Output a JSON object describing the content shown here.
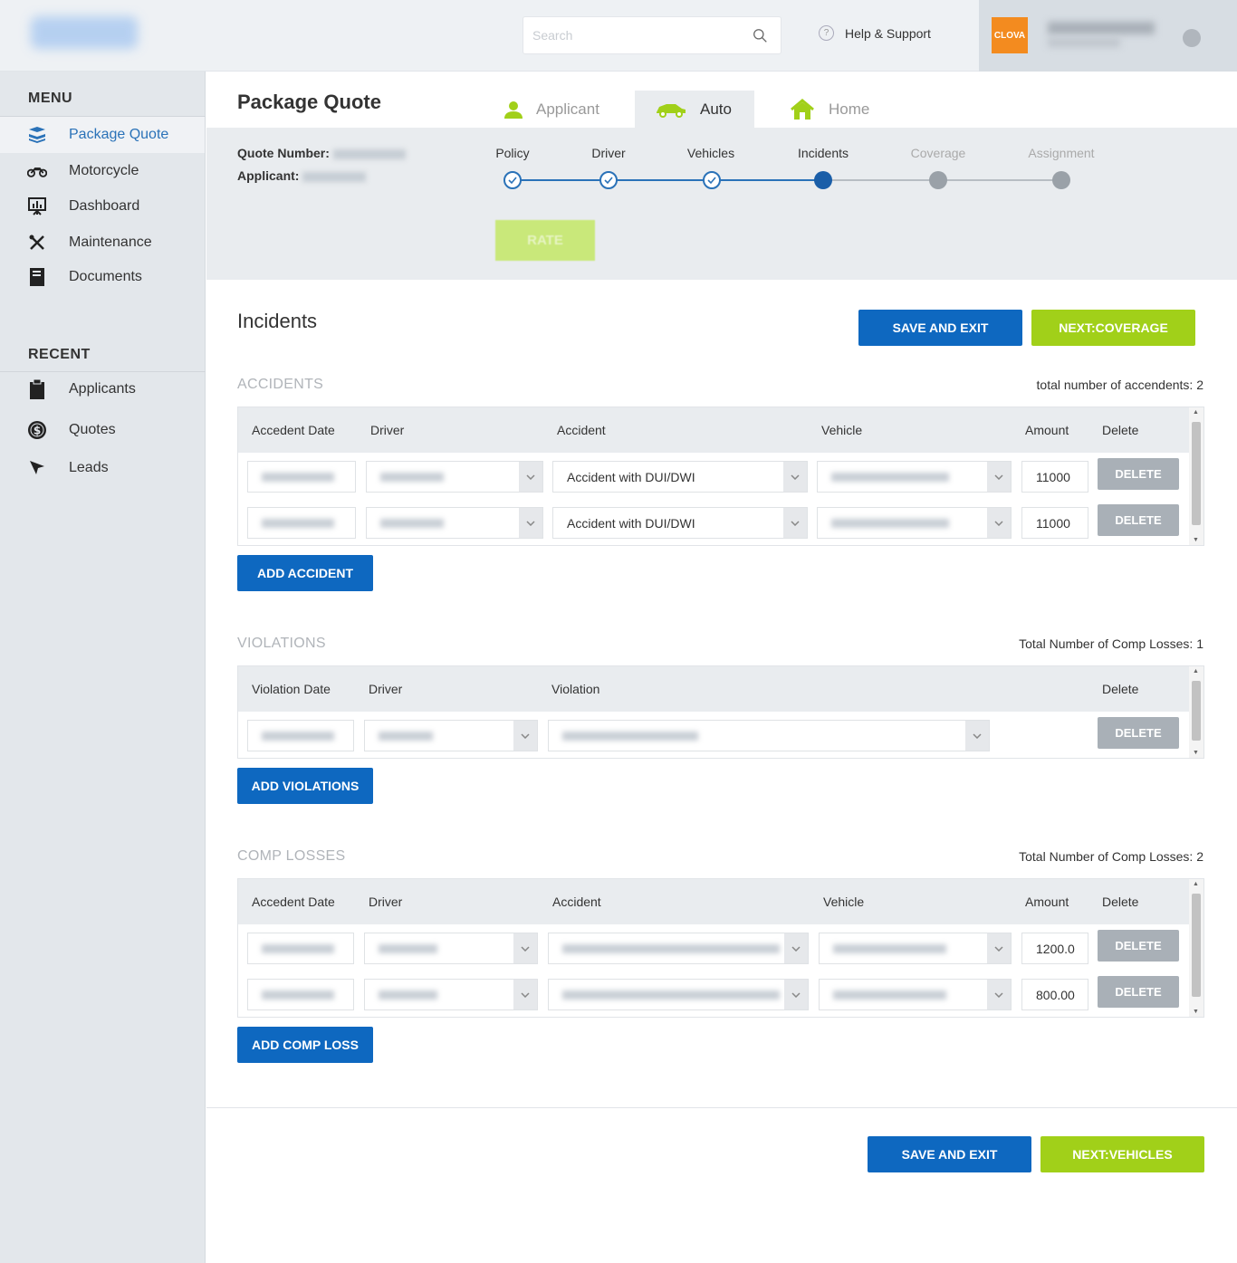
{
  "header": {
    "search_placeholder": "Search",
    "help_label": "Help & Support",
    "brand_text": "CLOVA"
  },
  "colors": {
    "primary": "#0e68c0",
    "accent": "#a1d019",
    "brand": "#f38b1f"
  },
  "sidebar": {
    "menu_title": "MENU",
    "menu": [
      {
        "label": "Package Quote",
        "icon": "package-icon"
      },
      {
        "label": "Motorcycle",
        "icon": "motorcycle-icon"
      },
      {
        "label": "Dashboard",
        "icon": "dashboard-icon"
      },
      {
        "label": "Maintenance",
        "icon": "tools-icon"
      },
      {
        "label": "Documents",
        "icon": "document-icon"
      }
    ],
    "recent_title": "RECENT",
    "recent": [
      {
        "label": "Applicants",
        "icon": "clipboard-icon"
      },
      {
        "label": "Quotes",
        "icon": "dollar-icon"
      },
      {
        "label": "Leads",
        "icon": "cursor-icon"
      }
    ]
  },
  "page": {
    "title": "Package Quote",
    "quote_label": "Quote Number:",
    "applicant_label": "Applicant:",
    "rate_label": "RATE"
  },
  "tabs": [
    {
      "label": "Applicant",
      "icon": "person-icon"
    },
    {
      "label": "Auto",
      "icon": "car-icon"
    },
    {
      "label": "Home",
      "icon": "home-icon"
    }
  ],
  "steps": [
    {
      "label": "Policy",
      "state": "done"
    },
    {
      "label": "Driver",
      "state": "done"
    },
    {
      "label": "Vehicles",
      "state": "done"
    },
    {
      "label": "Incidents",
      "state": "current"
    },
    {
      "label": "Coverage",
      "state": "future"
    },
    {
      "label": "Assignment",
      "state": "future"
    }
  ],
  "incidents": {
    "title": "Incidents",
    "save_label": "SAVE AND EXIT",
    "next_label": "NEXT:COVERAGE"
  },
  "accidents": {
    "title": "ACCIDENTS",
    "total": "total number of accendents: 2",
    "headers": [
      "Accedent Date",
      "Driver",
      "Accident",
      "Vehicle",
      "Amount",
      "Delete"
    ],
    "rows": [
      {
        "accident": "Accident with DUI/DWI",
        "amount": "11000"
      },
      {
        "accident": "Accident with DUI/DWI",
        "amount": "11000"
      }
    ],
    "add_label": "ADD ACCIDENT",
    "delete_label": "DELETE"
  },
  "violations": {
    "title": "VIOLATIONS",
    "total": "Total Number of Comp Losses: 1",
    "headers": [
      "Violation Date",
      "Driver",
      "Violation",
      "Delete"
    ],
    "add_label": "ADD VIOLATIONS",
    "delete_label": "DELETE"
  },
  "comp": {
    "title": "COMP LOSSES",
    "total": "Total Number of Comp Losses: 2",
    "headers": [
      "Accedent Date",
      "Driver",
      "Accident",
      "Vehicle",
      "Amount",
      "Delete"
    ],
    "rows": [
      {
        "amount": "1200.0"
      },
      {
        "amount": "800.00"
      }
    ],
    "add_label": "ADD COMP LOSS",
    "delete_label": "DELETE"
  },
  "footer": {
    "save_label": "SAVE AND EXIT",
    "next_label": "NEXT:VEHICLES"
  }
}
